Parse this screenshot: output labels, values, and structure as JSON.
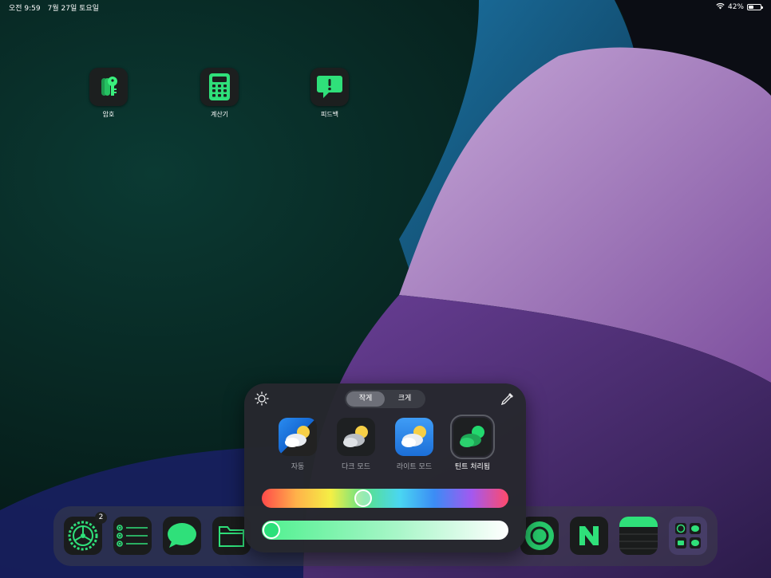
{
  "status_bar": {
    "time": "오전 9:59",
    "date": "7월 27일 토요일",
    "battery_text": "42%",
    "battery_level": 0.42
  },
  "home_apps": [
    {
      "label": "암호",
      "icon": "keys-icon"
    },
    {
      "label": "계산기",
      "icon": "calculator-icon"
    },
    {
      "label": "피드백",
      "icon": "feedback-icon"
    }
  ],
  "dock": {
    "settings_badge": "2",
    "icons": [
      "settings-icon",
      "reminders-icon",
      "messages-icon",
      "files-icon",
      "circle-app-icon",
      "naver-icon",
      "notes-icon",
      "app-folder-icon"
    ]
  },
  "customize_panel": {
    "size_options": [
      "작게",
      "크게"
    ],
    "selected_size": "작게",
    "styles": [
      {
        "label": "자동",
        "icon": "weather-auto-icon"
      },
      {
        "label": "다크 모드",
        "icon": "weather-dark-icon"
      },
      {
        "label": "라이트 모드",
        "icon": "weather-light-icon"
      },
      {
        "label": "틴트 처리됨",
        "icon": "weather-tinted-icon"
      }
    ],
    "selected_style": "틴트 처리됨",
    "hue_position": 0.405,
    "saturation_position": 0.0,
    "tint_color": "#2be07a",
    "accent_green": "#22d86e"
  }
}
